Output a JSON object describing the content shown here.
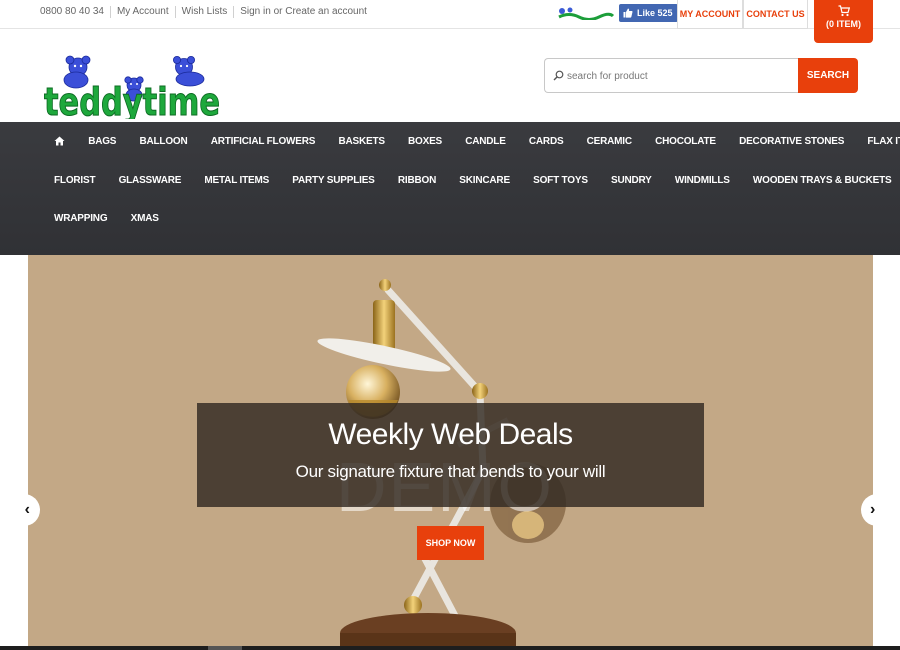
{
  "topbar": {
    "phone": "0800 80 40 34",
    "my_account_link": "My Account",
    "wish_lists_link": "Wish Lists",
    "sign_in_link": "Sign in or Create an account",
    "fb_like_label": "Like 525",
    "my_account_button": "MY ACCOUNT",
    "contact_us_button": "CONTACT US",
    "cart_label": "(0 ITEM)"
  },
  "header": {
    "logo_text": "teddytime",
    "search": {
      "placeholder": "search for product",
      "value": "",
      "button_label": "SEARCH"
    }
  },
  "nav": {
    "home_icon": "home-icon",
    "row1": [
      "BAGS",
      "BALLOON",
      "ARTIFICIAL FLOWERS",
      "BASKETS",
      "BOXES",
      "CANDLE",
      "CARDS",
      "CERAMIC",
      "CHOCOLATE",
      "DECORATIVE STONES",
      "FLAX ITEMS"
    ],
    "row2": [
      "FLORIST",
      "GLASSWARE",
      "METAL ITEMS",
      "PARTY SUPPLIES",
      "RIBBON",
      "SKINCARE",
      "SOFT TOYS",
      "SUNDRY",
      "WINDMILLS",
      "WOODEN TRAYS & BUCKETS"
    ],
    "row3": [
      "WRAPPING",
      "XMAS"
    ]
  },
  "hero": {
    "title": "Weekly Web Deals",
    "subtitle": "Our signature fixture that bends to your will",
    "watermark": "DEMO",
    "button_label": "SHOP NOW",
    "prev_arrow": "‹",
    "next_arrow": "›"
  },
  "colors": {
    "accent": "#e8400c",
    "nav_bg": "#36373b",
    "hero_bg": "#c3a886",
    "fb_blue": "#4267b2"
  }
}
